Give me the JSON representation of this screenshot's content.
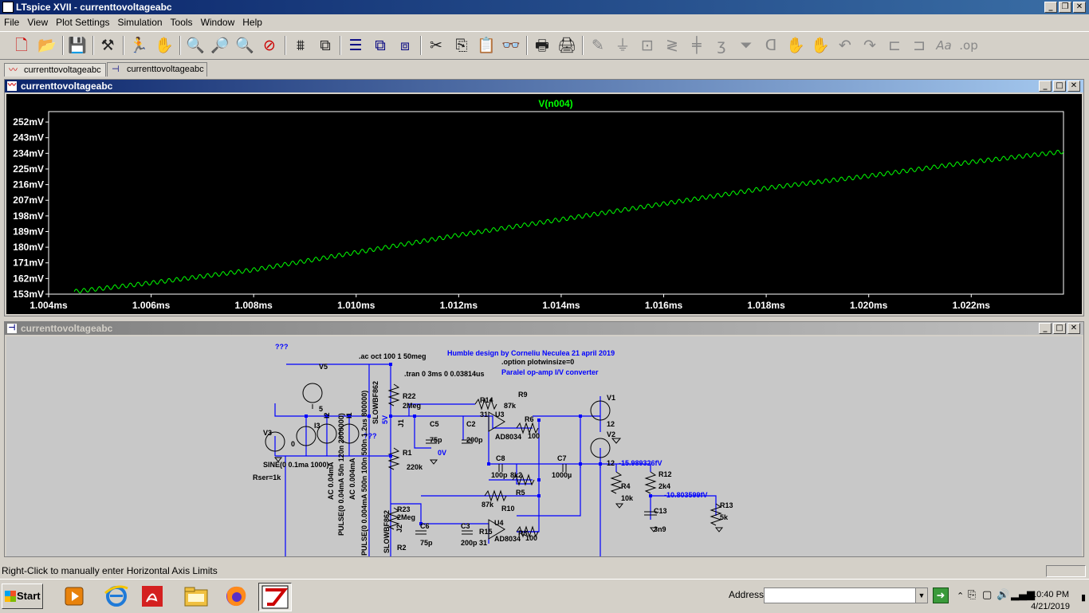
{
  "window": {
    "title": "LTspice XVII - currenttovoltageabc"
  },
  "menu": [
    "File",
    "View",
    "Plot Settings",
    "Simulation",
    "Tools",
    "Window",
    "Help"
  ],
  "tabs": [
    {
      "label": "currenttovoltageabc",
      "icon": "waveform-icon"
    },
    {
      "label": "currenttovoltageabc",
      "icon": "schematic-icon"
    }
  ],
  "plot_window": {
    "title": "currenttovoltageabc"
  },
  "schematic_window": {
    "title": "currenttovoltageabc"
  },
  "colors": {
    "trace": "#00ff00",
    "plot_bg": "#000000",
    "schematic_wire": "#0000ff",
    "title_active": "#0a246a"
  },
  "chart_data": {
    "type": "line",
    "title": "V(n004)",
    "xlabel": "",
    "ylabel": "",
    "xlim": [
      1.004,
      1.0238
    ],
    "ylim": [
      153,
      258
    ],
    "grid": false,
    "x_ticks": [
      "1.004ms",
      "1.006ms",
      "1.008ms",
      "1.010ms",
      "1.012ms",
      "1.014ms",
      "1.016ms",
      "1.018ms",
      "1.020ms",
      "1.022ms"
    ],
    "y_ticks": [
      "252mV",
      "243mV",
      "234mV",
      "225mV",
      "216mV",
      "207mV",
      "198mV",
      "189mV",
      "180mV",
      "171mV",
      "162mV",
      "153mV"
    ],
    "series": [
      {
        "color": "#00ff00",
        "ripple_mv": 1.2,
        "ripple_cycles": 128,
        "x": [
          1.0045,
          1.006,
          1.008,
          1.01,
          1.012,
          1.014,
          1.016,
          1.018,
          1.02,
          1.022,
          1.0238
        ],
        "y": [
          154.5,
          159.5,
          167,
          177,
          187,
          196,
          205,
          214,
          221,
          229,
          235
        ]
      }
    ]
  },
  "schematic": {
    "labels": [
      {
        "id": "t1",
        "text": "???"
      },
      {
        "id": "t2",
        "text": ".ac oct 100 1 50meg"
      },
      {
        "id": "t3",
        "text": "Humble design by Corneliu Neculea 21 april 2019"
      },
      {
        "id": "t4",
        "text": ".option plotwinsize=0"
      },
      {
        "id": "t5",
        "text": ".tran 0 3ms 0 0.03814us"
      },
      {
        "id": "t6",
        "text": "Paralel op-amp I/V converter"
      },
      {
        "id": "t7",
        "text": "V5"
      },
      {
        "id": "t8",
        "text": "5"
      },
      {
        "id": "t9",
        "text": "R22"
      },
      {
        "id": "t10",
        "text": "2Meg"
      },
      {
        "id": "t11",
        "text": "5V"
      },
      {
        "id": "t12",
        "text": "J1"
      },
      {
        "id": "t13",
        "text": "R14"
      },
      {
        "id": "t14",
        "text": "R9"
      },
      {
        "id": "t15",
        "text": "87k"
      },
      {
        "id": "t16",
        "text": "31"
      },
      {
        "id": "t17",
        "text": "U3"
      },
      {
        "id": "t18",
        "text": "R6"
      },
      {
        "id": "t19",
        "text": "V1"
      },
      {
        "id": "t20",
        "text": "12"
      },
      {
        "id": "t21",
        "text": "V2"
      },
      {
        "id": "t22",
        "text": "C5"
      },
      {
        "id": "t23",
        "text": "C2"
      },
      {
        "id": "t24",
        "text": "75p"
      },
      {
        "id": "t25",
        "text": "200p"
      },
      {
        "id": "t26",
        "text": "AD8034"
      },
      {
        "id": "t27",
        "text": "100"
      },
      {
        "id": "t28",
        "text": "V3"
      },
      {
        "id": "t29",
        "text": "I3"
      },
      {
        "id": "t30",
        "text": "I2"
      },
      {
        "id": "t31",
        "text": "I1"
      },
      {
        "id": "t32",
        "text": "0"
      },
      {
        "id": "t33",
        "text": "R1"
      },
      {
        "id": "t34",
        "text": "220k"
      },
      {
        "id": "t35",
        "text": "0V"
      },
      {
        "id": "t36",
        "text": "C8"
      },
      {
        "id": "t37",
        "text": "C7"
      },
      {
        "id": "t38",
        "text": "12"
      },
      {
        "id": "t39",
        "text": "-15.989326fV"
      },
      {
        "id": "t40",
        "text": "SINE(0 0.1ma 1000)"
      },
      {
        "id": "t41",
        "text": "Rser=1k"
      },
      {
        "id": "t42",
        "text": "100p"
      },
      {
        "id": "t43",
        "text": "8k2"
      },
      {
        "id": "t44",
        "text": "1000µ"
      },
      {
        "id": "t45",
        "text": "R12"
      },
      {
        "id": "t46",
        "text": "2k4"
      },
      {
        "id": "t47",
        "text": "R4"
      },
      {
        "id": "t48",
        "text": "10k"
      },
      {
        "id": "t49",
        "text": "R5"
      },
      {
        "id": "t50",
        "text": "-10.803599fV"
      },
      {
        "id": "t51",
        "text": "R13"
      },
      {
        "id": "t52",
        "text": "5k"
      },
      {
        "id": "t53",
        "text": "C13"
      },
      {
        "id": "t54",
        "text": "3n9"
      },
      {
        "id": "t55",
        "text": "87k"
      },
      {
        "id": "t56",
        "text": "R10"
      },
      {
        "id": "t57",
        "text": "R23"
      },
      {
        "id": "t58",
        "text": "2Meg"
      },
      {
        "id": "t59",
        "text": "J2"
      },
      {
        "id": "t60",
        "text": "C6"
      },
      {
        "id": "t61",
        "text": "C3"
      },
      {
        "id": "t62",
        "text": "R15"
      },
      {
        "id": "t63",
        "text": "U4"
      },
      {
        "id": "t64",
        "text": "R3"
      },
      {
        "id": "t65",
        "text": "75p"
      },
      {
        "id": "t66",
        "text": "200p"
      },
      {
        "id": "t67",
        "text": "31"
      },
      {
        "id": "t68",
        "text": "AD8034"
      },
      {
        "id": "t69",
        "text": "100"
      },
      {
        "id": "t70",
        "text": "R2"
      },
      {
        "id": "t71",
        "text": "???"
      },
      {
        "id": "t72",
        "text": "AC 0.04mA"
      },
      {
        "id": "t73",
        "text": "PULSE(0 0.04mA 50n 120n 2000000)"
      },
      {
        "id": "t74",
        "text": "AC 0.004mA"
      },
      {
        "id": "t75",
        "text": "PULSE(0 0.004mA 500n 100n 500n 1.2us 800000)"
      },
      {
        "id": "t76",
        "text": "SLOWBF862"
      },
      {
        "id": "t77",
        "text": "SLOWBF862"
      }
    ]
  },
  "status": {
    "text": "Right-Click to manually enter Horizontal Axis Limits"
  },
  "taskbar": {
    "start": "Start",
    "address_label": "Address",
    "address_value": "",
    "time": "10:40 PM",
    "date": "4/21/2019"
  }
}
